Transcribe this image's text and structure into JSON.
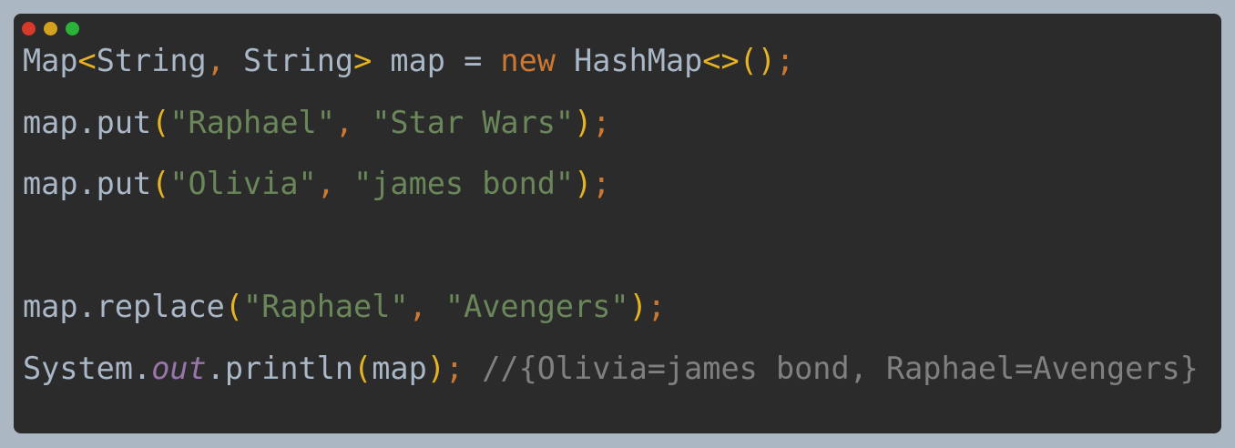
{
  "window": {
    "controls": [
      {
        "name": "close-button",
        "color": "#d63a2b"
      },
      {
        "name": "minimize-button",
        "color": "#d4a020"
      },
      {
        "name": "zoom-button",
        "color": "#2bb239"
      }
    ]
  },
  "colors": {
    "background": "#abb8c3",
    "editor": "#2b2b2b",
    "text": "#a9b7c6",
    "keyword": "#cc7832",
    "string": "#6a8759",
    "bracket": "#e6b422",
    "field": "#9876aa",
    "comment": "#808080"
  },
  "code": {
    "lines": [
      [
        {
          "t": "Map",
          "c": "plain"
        },
        {
          "t": "<",
          "c": "br"
        },
        {
          "t": "String",
          "c": "plain"
        },
        {
          "t": ",",
          "c": "pun"
        },
        {
          "t": " String",
          "c": "plain"
        },
        {
          "t": ">",
          "c": "br"
        },
        {
          "t": " map = ",
          "c": "plain"
        },
        {
          "t": "new",
          "c": "kw"
        },
        {
          "t": " HashMap",
          "c": "plain"
        },
        {
          "t": "<>()",
          "c": "br"
        },
        {
          "t": ";",
          "c": "pun"
        }
      ],
      [
        {
          "t": "map.put",
          "c": "plain"
        },
        {
          "t": "(",
          "c": "br"
        },
        {
          "t": "\"Raphael\"",
          "c": "str"
        },
        {
          "t": ", ",
          "c": "pun"
        },
        {
          "t": "\"Star Wars\"",
          "c": "str"
        },
        {
          "t": ")",
          "c": "br"
        },
        {
          "t": ";",
          "c": "pun"
        }
      ],
      [
        {
          "t": "map.put",
          "c": "plain"
        },
        {
          "t": "(",
          "c": "br"
        },
        {
          "t": "\"Olivia\"",
          "c": "str"
        },
        {
          "t": ", ",
          "c": "pun"
        },
        {
          "t": "\"james bond\"",
          "c": "str"
        },
        {
          "t": ")",
          "c": "br"
        },
        {
          "t": ";",
          "c": "pun"
        }
      ],
      [],
      [
        {
          "t": "map.replace",
          "c": "plain"
        },
        {
          "t": "(",
          "c": "br"
        },
        {
          "t": "\"Raphael\"",
          "c": "str"
        },
        {
          "t": ", ",
          "c": "pun"
        },
        {
          "t": "\"Avengers\"",
          "c": "str"
        },
        {
          "t": ")",
          "c": "br"
        },
        {
          "t": ";",
          "c": "pun"
        }
      ],
      [
        {
          "t": "System.",
          "c": "plain"
        },
        {
          "t": "out",
          "c": "fld"
        },
        {
          "t": ".println",
          "c": "plain"
        },
        {
          "t": "(",
          "c": "br"
        },
        {
          "t": "map",
          "c": "plain"
        },
        {
          "t": ")",
          "c": "br"
        },
        {
          "t": ";",
          "c": "pun"
        },
        {
          "t": " //{Olivia=james bond, Raphael=Avengers}",
          "c": "cmt"
        }
      ]
    ]
  }
}
